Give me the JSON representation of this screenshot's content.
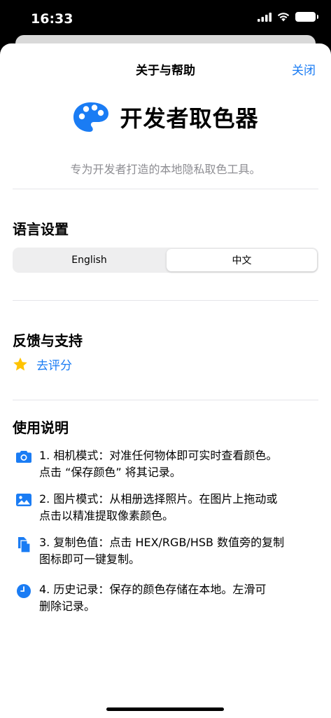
{
  "status": {
    "time": "16:33"
  },
  "nav": {
    "title": "关于与帮助",
    "close_label": "关闭"
  },
  "app": {
    "name": "开发者取色器",
    "tagline": "专为开发者打造的本地隐私取色工具。"
  },
  "language": {
    "title": "语言设置",
    "options": [
      "English",
      "中文"
    ],
    "selected": "中文"
  },
  "feedback": {
    "title": "反馈与支持",
    "rate_label": "去评分"
  },
  "instructions": {
    "title": "使用说明",
    "items": [
      {
        "icon": "camera-icon",
        "lines": [
          "1. 相机模式：对准任何物体即可实时查看颜色。",
          "点击 “保存颜色” 将其记录。"
        ]
      },
      {
        "icon": "photo-icon",
        "lines": [
          "2. 图片模式：从相册选择照片。在图片上拖动或",
          "点击以精准提取像素颜色。"
        ]
      },
      {
        "icon": "copy-doc-icon",
        "lines": [
          "3. 复制色值：点击 HEX/RGB/HSB 数值旁的复制",
          "图标即可一键复制。"
        ]
      },
      {
        "icon": "clock-icon",
        "lines": [
          "4. 历史记录：保存的颜色存储在本地。左滑可",
          "删除记录。"
        ]
      }
    ]
  },
  "colors": {
    "accent": "#1A7CF4",
    "star": "#FFC300",
    "secondary_text": "#8E8E93"
  }
}
